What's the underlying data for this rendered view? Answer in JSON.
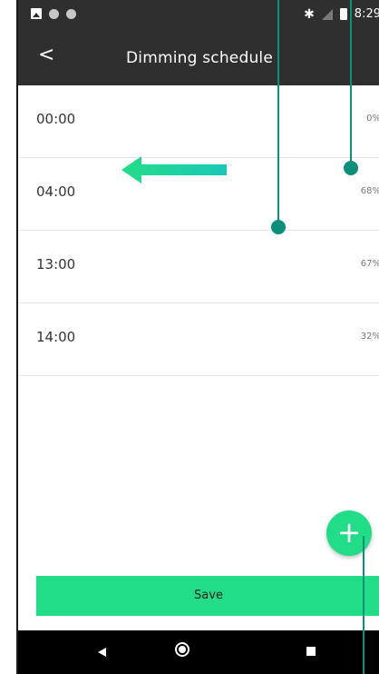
{
  "status": {
    "time": "8:29",
    "icons": [
      "image-icon",
      "circle-icon",
      "circle-icon",
      "bluetooth-icon",
      "signal-icon",
      "battery-icon"
    ]
  },
  "header": {
    "title": "Dimming schedule",
    "back_label": "<"
  },
  "schedule": [
    {
      "time": "00:00",
      "percent": "0%"
    },
    {
      "time": "04:00",
      "percent": "68%"
    },
    {
      "time": "13:00",
      "percent": "67%"
    },
    {
      "time": "14:00",
      "percent": "32%"
    }
  ],
  "fab": {
    "label": "+"
  },
  "save_button": {
    "label": "Save"
  },
  "colors": {
    "accent": "#22dd88",
    "annotation": "#0a8f7a",
    "bar": "#2f2f2f"
  }
}
